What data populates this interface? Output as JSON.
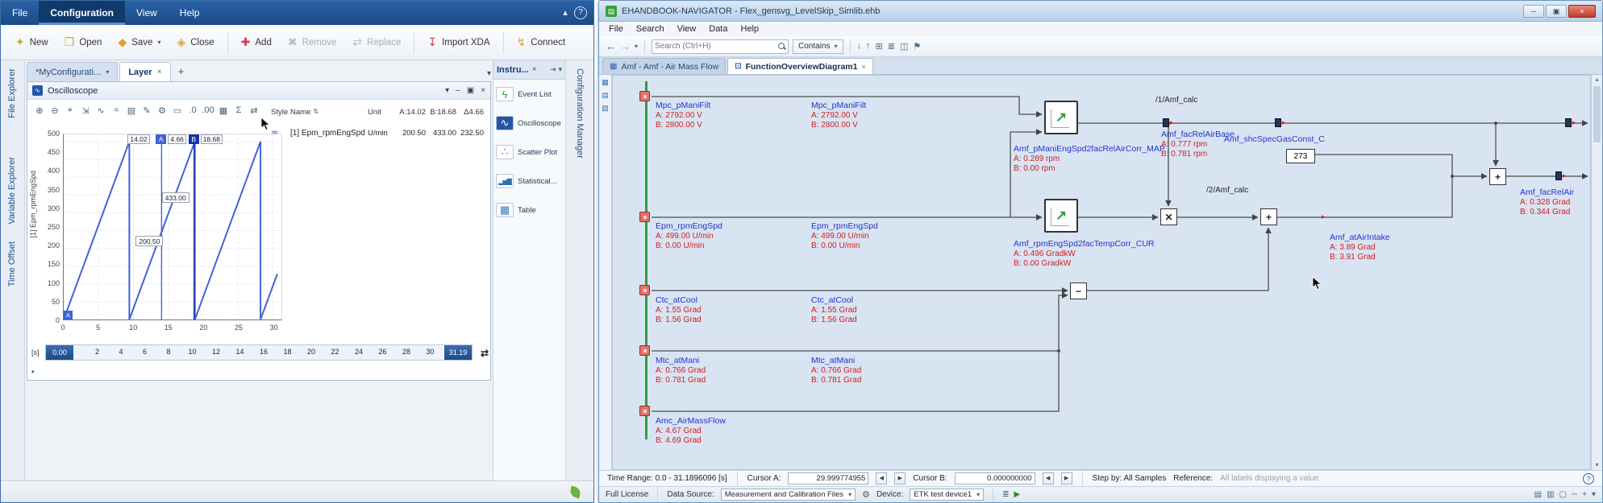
{
  "left_window": {
    "menu": {
      "items": [
        {
          "label": "File"
        },
        {
          "label": "Configuration"
        },
        {
          "label": "View"
        },
        {
          "label": "Help"
        }
      ]
    },
    "titlebar_icons": {
      "collapse": "▴",
      "help": "?"
    },
    "toolbar": {
      "buttons": [
        {
          "label": "New",
          "glyph": "✦"
        },
        {
          "label": "Open",
          "glyph": "❒"
        },
        {
          "label": "Save",
          "glyph": "◆",
          "dropdown": "▾"
        },
        {
          "label": "Close",
          "glyph": "◈"
        },
        {
          "label": "Add",
          "glyph": "✚"
        },
        {
          "label": "Remove",
          "glyph": "✖"
        },
        {
          "label": "Replace",
          "glyph": "⇄"
        },
        {
          "label": "Import XDA",
          "glyph": "↧"
        },
        {
          "label": "Connect",
          "glyph": "↯"
        }
      ]
    },
    "left_rail": [
      {
        "label": "File Explorer"
      },
      {
        "label": "Variable Explorer"
      },
      {
        "label": "Time Offset"
      }
    ],
    "right_rail": {
      "label": "Configuration Manager"
    },
    "tabs": [
      {
        "label": "*MyConfigurati...",
        "caret": "▾"
      },
      {
        "label": "Layer",
        "close": "×"
      }
    ],
    "new_tab": "+",
    "tab_end_caret": "▾",
    "oscilloscope": {
      "title": "Oscilloscope",
      "header_icons": [
        "▾",
        "‒",
        "▣",
        "×"
      ],
      "toolbar_icons": [
        "⊕",
        "⊖",
        "⌖",
        "⇲",
        "∿",
        "≈",
        "▤",
        "✎",
        "⚙",
        "▭",
        ".0",
        ".00",
        "▦",
        "Σ",
        "⇄"
      ],
      "legend": {
        "headers": {
          "style": "Style",
          "name": "Name",
          "sort": "⇅",
          "unit": "Unit",
          "a": "A:14.02",
          "b": "B:18.68",
          "delta": "Δ4.66"
        },
        "row": {
          "swatch": "≋",
          "name": "[1] Epm_rpmEngSpd",
          "unit": "U/min",
          "a": "200.50",
          "b": "433.00",
          "delta": "232.50"
        }
      },
      "cursor_labels": {
        "a_time": "14.02",
        "a": "A",
        "delta": "4.66",
        "b": "B",
        "b_time": "18.68",
        "b_value": "433.00",
        "a_value": "200.50"
      },
      "y_axis_title": "[1] Epm_rpmEngSpd",
      "timeline": {
        "unit": "[s]",
        "start": "0.00",
        "end": "31.19",
        "arrows": "⇄"
      },
      "footer_glyph": "▪"
    },
    "chart_data": {
      "type": "line",
      "title": "Oscilloscope",
      "series": [
        {
          "name": "[1] Epm_rpmEngSpd",
          "unit": "U/min",
          "points": [
            [
              0,
              0
            ],
            [
              9.4,
              500
            ],
            [
              9.4,
              0
            ],
            [
              18.8,
              500
            ],
            [
              18.8,
              0
            ],
            [
              28.2,
              500
            ],
            [
              28.2,
              0
            ],
            [
              30.6,
              128
            ]
          ]
        }
      ],
      "xlim": [
        0,
        31.19
      ],
      "ylim": [
        0,
        520
      ],
      "x_ticks": [
        0,
        5,
        10,
        15,
        20,
        25,
        30
      ],
      "y_ticks": [
        0,
        50,
        100,
        150,
        200,
        250,
        300,
        350,
        400,
        450,
        500
      ],
      "timeline_ticks": [
        2,
        4,
        6,
        8,
        10,
        12,
        14,
        16,
        18,
        20,
        22,
        24,
        26,
        28,
        30
      ],
      "cursors": {
        "a": {
          "x": 14.02,
          "value": 200.5
        },
        "b": {
          "x": 18.68,
          "value": 433.0
        },
        "delta_time": 4.66,
        "delta_value": 232.5
      },
      "grid": true,
      "legend_position": "right"
    },
    "instruments": {
      "title": "Instru...",
      "close": "×",
      "pin_icons": [
        "⇥",
        "▾"
      ],
      "items": [
        {
          "label": "Event List",
          "glyph": "ϟ"
        },
        {
          "label": "Oscilloscope",
          "glyph": "∿"
        },
        {
          "label": "Scatter Plot",
          "glyph": "∴"
        },
        {
          "label": "Statistical...",
          "glyph": "▂▅▇"
        },
        {
          "label": "Table",
          "glyph": "▦"
        }
      ]
    }
  },
  "right_window": {
    "title": "EHANDBOOK-NAVIGATOR - Flex_gensvg_LevelSkip_Simlib.ehb",
    "app_icon_glyph": "▤",
    "window_buttons": {
      "minimize": "─",
      "maximize": "▣",
      "close": "×"
    },
    "menu": {
      "items": [
        {
          "label": "File"
        },
        {
          "label": "Search"
        },
        {
          "label": "View"
        },
        {
          "label": "Data"
        },
        {
          "label": "Help"
        }
      ]
    },
    "toolbar": {
      "back": "←",
      "forward": "→",
      "caret": "▾",
      "search_placeholder": "Search (Ctrl+H)",
      "filter": "Contains",
      "filter_caret": "▾",
      "icons": [
        "↓",
        "↑",
        "⊞",
        "≣",
        "◫",
        "⚑"
      ]
    },
    "tabs": [
      {
        "label": "Amf - Amf - Air Mass Flow",
        "icon": "▦"
      },
      {
        "label": "FunctionOverviewDiagram1",
        "icon": "⊡",
        "close": "×"
      }
    ],
    "side_icons": [
      "▦",
      "▤",
      "▧"
    ],
    "scrollbar": {
      "up": "▴",
      "down": "▾"
    },
    "diagram": {
      "region_labels": [
        {
          "text": "/1/Amf_calc"
        },
        {
          "text": "/2/Amf_calc"
        }
      ],
      "constant_value": "273",
      "operators": {
        "multiply": "✕",
        "plus": "+",
        "minus": "−"
      },
      "fn_glyph": "↗",
      "tap_glyph": "▸",
      "signals": [
        {
          "name": "Mpc_pManiFilt",
          "a": "A: 2792.00 V",
          "b": "B: 2800.00 V"
        },
        {
          "name": "Epm_rpmEngSpd",
          "a": "A: 499.00 U/min",
          "b": "B: 0.00 U/min"
        },
        {
          "name": "Ctc_atCool",
          "a": "A: 1.55 Grad",
          "b": "B: 1.56 Grad"
        },
        {
          "name": "Mtc_atMani",
          "a": "A: 0.766 Grad",
          "b": "B: 0.781 Grad"
        },
        {
          "name": "Amc_AirMassFlow",
          "a": "A: 4.67 Grad",
          "b": "B: 4.69 Grad"
        },
        {
          "name": "Amf_pManiEngSpd2facRelAirCorr_MAP",
          "a": "A: 0.289 rpm",
          "b": "B: 0.00 rpm"
        },
        {
          "name": "Amf_facRelAirBase",
          "a": "A: 0.777 rpm",
          "b": "B: 0.781 rpm"
        },
        {
          "name": "Amf_rpmEngSpd2facTempCorr_CUR",
          "a": "A: 0.496 GradkW",
          "b": "B: 0.00 GradkW"
        },
        {
          "name": "Amf_shcSpecGasConst_C"
        },
        {
          "name": "Amf_atAirIntake",
          "a": "A: 3.89 Grad",
          "b": "B: 3.91 Grad"
        },
        {
          "name": "Amf_facRelAir",
          "a": "A: 0.328 Grad",
          "b": "B: 0.344 Grad"
        }
      ]
    },
    "status_bar": {
      "time_range": "Time Range: 0.0 - 31.1896096 [s]",
      "cursor_a_label": "Cursor A:",
      "cursor_a_value": "29.999774955",
      "cursor_b_label": "Cursor B:",
      "cursor_b_value": "0.000000000",
      "spin_left": "◀",
      "spin_right": "▶",
      "step_by": "Step by: All Samples",
      "reference_label": "Reference:",
      "reference_value": "All labels displaying a value",
      "help": "?"
    },
    "footer": {
      "license": "Full License",
      "data_source_label": "Data Source:",
      "data_source_value": "Measurement and Calibration Files",
      "dd_caret": "▾",
      "device_label": "Device:",
      "device_value": "ETK test device1",
      "gear": "⚙",
      "left_icons": [
        "≣",
        "▶"
      ],
      "right_icons": [
        "▤",
        "▥",
        "▢",
        "─",
        "+",
        "▾"
      ]
    }
  }
}
